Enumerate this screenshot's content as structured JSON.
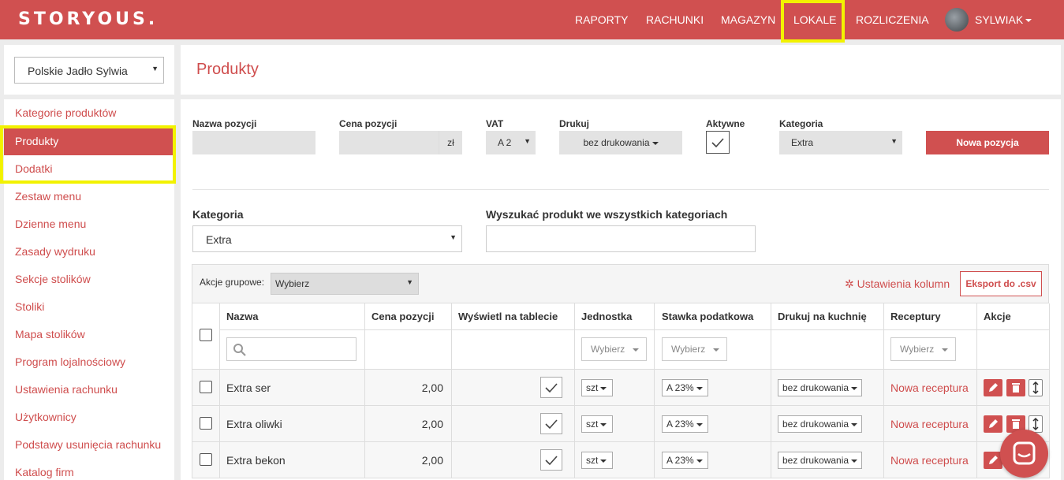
{
  "topbar": {
    "logo": "STORYOUS.",
    "nav": [
      "RAPORTY",
      "RACHUNKI",
      "MAGAZYN",
      "LOKALE",
      "ROZLICZENIA"
    ],
    "user": "SYLWIAK"
  },
  "sidebar": {
    "venue": "Polskie Jadło Sylwia",
    "items": [
      "Kategorie produktów",
      "Produkty",
      "Dodatki",
      "Zestaw menu",
      "Dzienne menu",
      "Zasady wydruku",
      "Sekcje stolików",
      "Stoliki",
      "Mapa stolików",
      "Program lojalnościowy",
      "Ustawienia rachunku",
      "Użytkownicy",
      "Podstawy usunięcia rachunku",
      "Katalog firm"
    ]
  },
  "page": {
    "title": "Produkty"
  },
  "form": {
    "name_label": "Nazwa pozycji",
    "price_label": "Cena pozycji",
    "price_suffix": "zł",
    "vat_label": "VAT",
    "vat_value": "A 2",
    "print_label": "Drukuj",
    "print_value": "bez drukowania",
    "active_label": "Aktywne",
    "category_label": "Kategoria",
    "category_value": "Extra",
    "new_button": "Nowa pozycja"
  },
  "filter": {
    "category_label": "Kategoria",
    "category_value": "Extra",
    "search_label": "Wyszukać produkt we wszystkich kategoriach"
  },
  "table": {
    "group_label": "Akcje grupowe:",
    "group_value": "Wybierz",
    "columns_settings": "Ustawienia kolumn",
    "export": "Eksport do .csv",
    "headers": [
      "Nazwa",
      "Cena pozycji",
      "Wyświetl na tablecie",
      "Jednostka",
      "Stawka podatkowa",
      "Drukuj na kuchnię",
      "Receptury",
      "Akcje"
    ],
    "filter_placeholder": "Wybierz",
    "rows": [
      {
        "name": "Extra ser",
        "price": "2,00",
        "unit": "szt",
        "vat": "A 23%",
        "print": "bez drukowania",
        "recipe": "Nowa receptura"
      },
      {
        "name": "Extra oliwki",
        "price": "2,00",
        "unit": "szt",
        "vat": "A 23%",
        "print": "bez drukowania",
        "recipe": "Nowa receptura"
      },
      {
        "name": "Extra bekon",
        "price": "2,00",
        "unit": "szt",
        "vat": "A 23%",
        "print": "bez drukowania",
        "recipe": "Nowa receptura"
      }
    ]
  },
  "colors": {
    "brand": "#d05050",
    "highlight": "#f2f200"
  }
}
